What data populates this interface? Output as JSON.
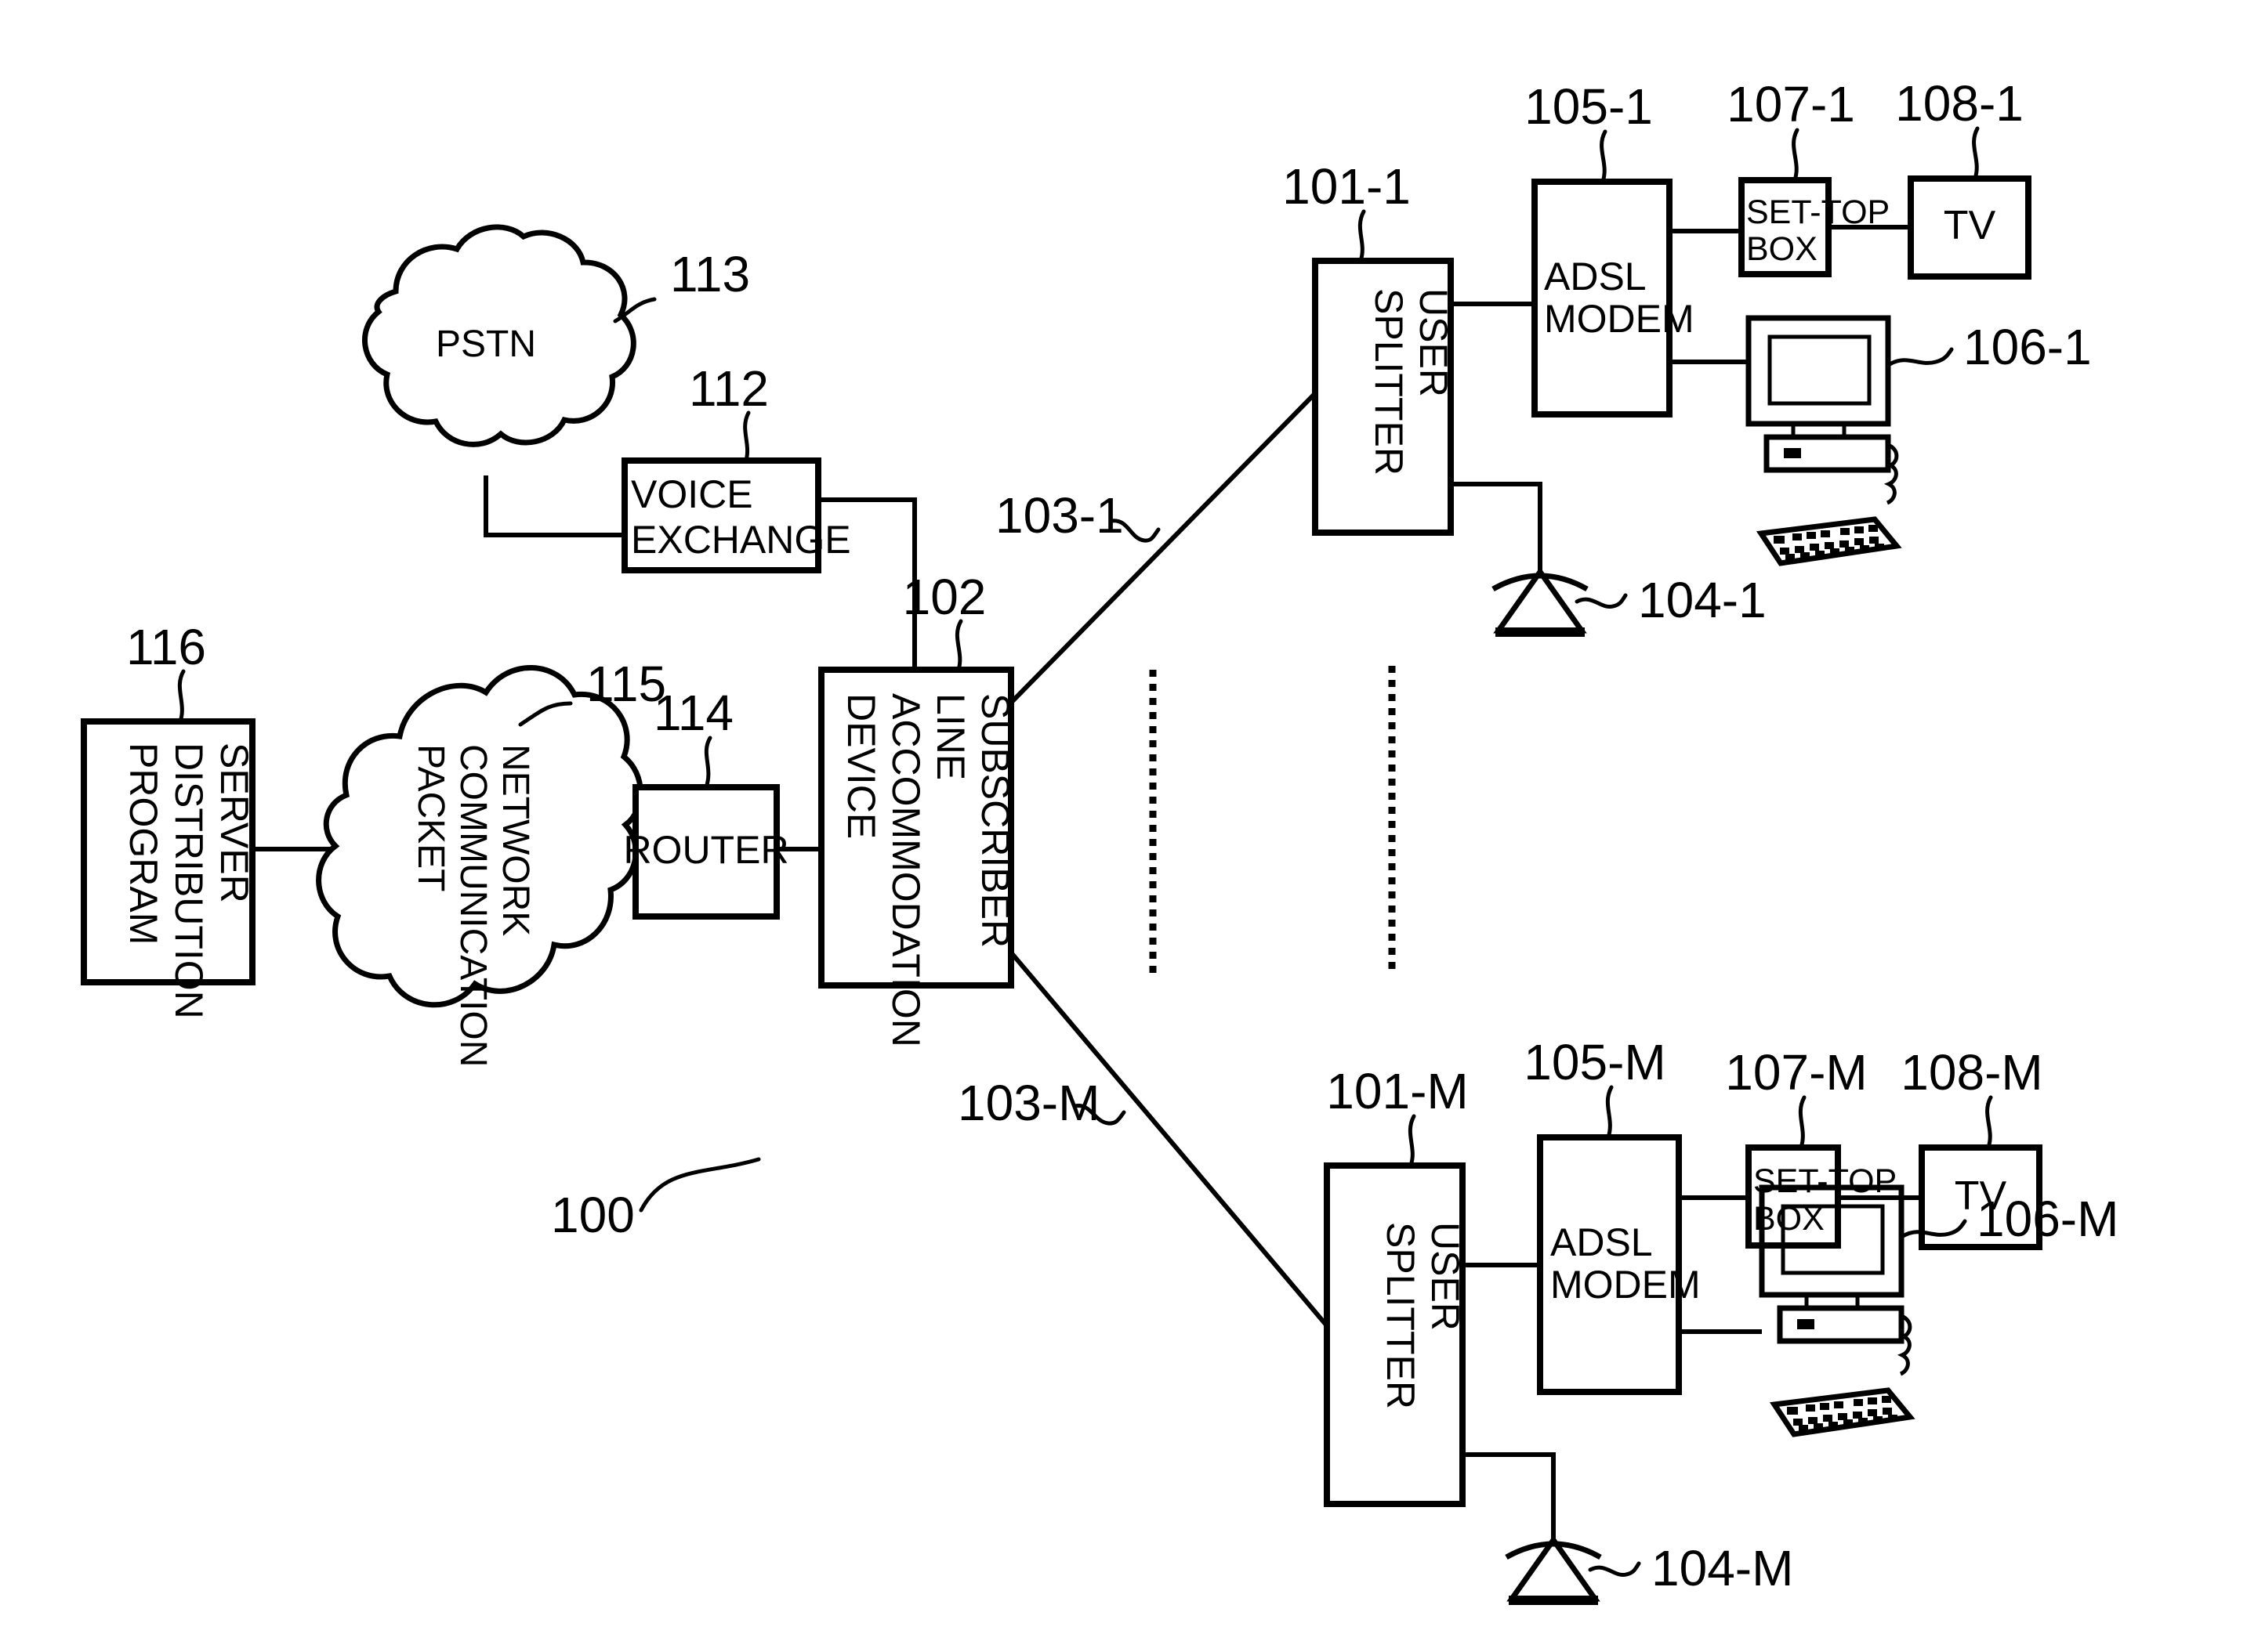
{
  "figure": {
    "system_ref": "100",
    "nodes": {
      "pstn": {
        "label": "PSTN",
        "ref": "113"
      },
      "voice_exchange": {
        "label_line1": "VOICE",
        "label_line2": "EXCHANGE",
        "ref": "112"
      },
      "program_distribution_server": {
        "label_line1": "PROGRAM",
        "label_line2": "DISTRIBUTION",
        "label_line3": "SERVER",
        "ref": "116"
      },
      "packet_communication_network": {
        "label_line1": "PACKET",
        "label_line2": "COMMUNICATION",
        "label_line3": "NETWORK",
        "ref": "115"
      },
      "router": {
        "label": "ROUTER",
        "ref": "114"
      },
      "subscriber_line_accommodation_device": {
        "label_line1": "SUBSCRIBER",
        "label_line2": "LINE",
        "label_line3": "ACCOMMODATION",
        "label_line4": "DEVICE",
        "ref": "102"
      }
    },
    "subscriber_lines": [
      {
        "ref": "103-1"
      },
      {
        "ref": "103-M"
      }
    ],
    "branches": [
      {
        "index": "1",
        "user_splitter": {
          "label_line1": "USER",
          "label_line2": "SPLITTER",
          "ref": "101-1"
        },
        "telephone": {
          "ref": "104-1"
        },
        "adsl_modem": {
          "label_line1": "ADSL",
          "label_line2": "MODEM",
          "ref": "105-1"
        },
        "personal_computer": {
          "ref": "106-1"
        },
        "set_top_box": {
          "label_line1": "SET-TOP",
          "label_line2": "BOX",
          "ref": "107-1"
        },
        "tv": {
          "label": "TV",
          "ref": "108-1"
        }
      },
      {
        "index": "M",
        "user_splitter": {
          "label_line1": "USER",
          "label_line2": "SPLITTER",
          "ref": "101-M"
        },
        "telephone": {
          "ref": "104-M"
        },
        "adsl_modem": {
          "label_line1": "ADSL",
          "label_line2": "MODEM",
          "ref": "105-M"
        },
        "personal_computer": {
          "ref": "106-M"
        },
        "set_top_box": {
          "label_line1": "SET-TOP",
          "label_line2": "BOX",
          "ref": "107-M"
        },
        "tv": {
          "label": "TV",
          "ref": "108-M"
        }
      }
    ],
    "colors": {
      "ink": "#000000",
      "paper": "#ffffff"
    }
  }
}
